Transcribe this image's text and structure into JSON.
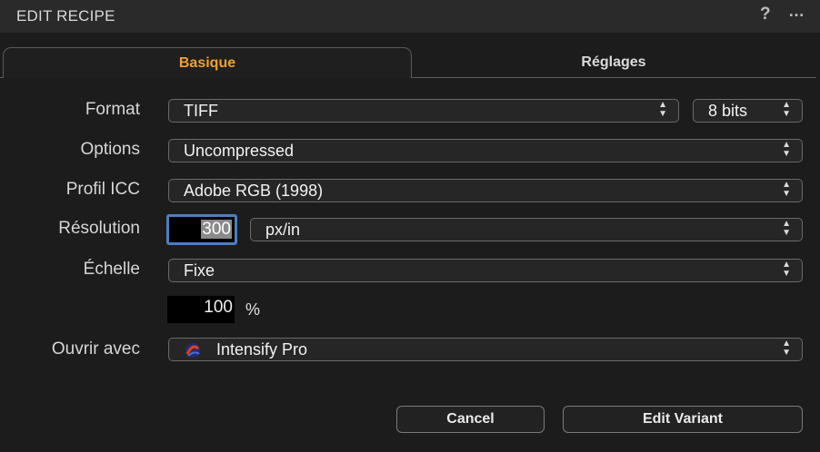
{
  "window": {
    "title": "EDIT RECIPE",
    "help_glyph": "?",
    "more_glyph": "…"
  },
  "tabs": [
    {
      "label": "Basique",
      "active": true
    },
    {
      "label": "Réglages",
      "active": false
    }
  ],
  "form": {
    "format": {
      "label": "Format",
      "value": "TIFF",
      "bitdepth": "8 bits"
    },
    "options": {
      "label": "Options",
      "value": "Uncompressed"
    },
    "icc": {
      "label": "Profil ICC",
      "value": "Adobe RGB (1998)"
    },
    "resolution": {
      "label": "Résolution",
      "value": "300",
      "unit": "px/in"
    },
    "scale": {
      "label": "Échelle",
      "value": "Fixe",
      "amount": "100",
      "unit": "%"
    },
    "open_with": {
      "label": "Ouvrir avec",
      "value": "Intensify Pro",
      "icon": "intensify-app-icon"
    }
  },
  "buttons": {
    "cancel": "Cancel",
    "edit_variant": "Edit Variant"
  },
  "colors": {
    "accent_tab": "#f0a030",
    "focus_ring": "#4d7fc0"
  },
  "stepper_glyph": "▲▼"
}
